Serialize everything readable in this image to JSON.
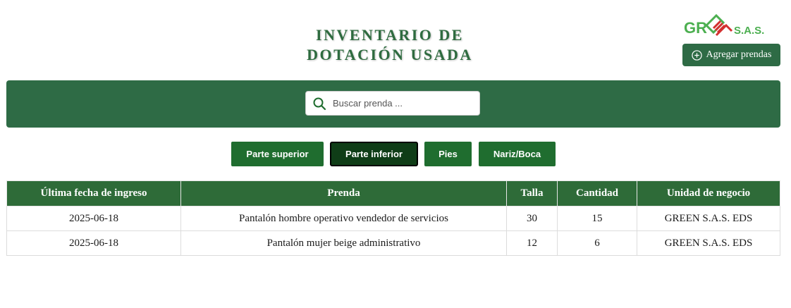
{
  "header": {
    "title_line1": "INVENTARIO DE",
    "title_line2": "DOTACIÓN USADA",
    "logo": {
      "text_left": "GR",
      "text_right": "S.A.S.",
      "color_green": "#4caf50",
      "color_red": "#d32f2f"
    },
    "add_button_label": "Agregar prendas",
    "add_button_icon": "plus-circle-icon"
  },
  "search": {
    "placeholder": "Buscar prenda ...",
    "value": "",
    "icon": "search-icon"
  },
  "tabs": [
    {
      "label": "Parte superior",
      "active": false
    },
    {
      "label": "Parte inferior",
      "active": true
    },
    {
      "label": "Pies",
      "active": false
    },
    {
      "label": "Nariz/Boca",
      "active": false
    }
  ],
  "table": {
    "columns": [
      "Última fecha de ingreso",
      "Prenda",
      "Talla",
      "Cantidad",
      "Unidad de negocio"
    ],
    "rows": [
      [
        "2025-06-18",
        "Pantalón hombre operativo vendedor de servicios",
        "30",
        "15",
        "GREEN S.A.S. EDS"
      ],
      [
        "2025-06-18",
        "Pantalón mujer beige administrativo",
        "12",
        "6",
        "GREEN S.A.S. EDS"
      ]
    ]
  },
  "colors": {
    "brand_green": "#2e6b45",
    "tab_green": "#1f6d2f",
    "tab_active": "#0f3d17",
    "title_green": "#2e6b3f"
  }
}
